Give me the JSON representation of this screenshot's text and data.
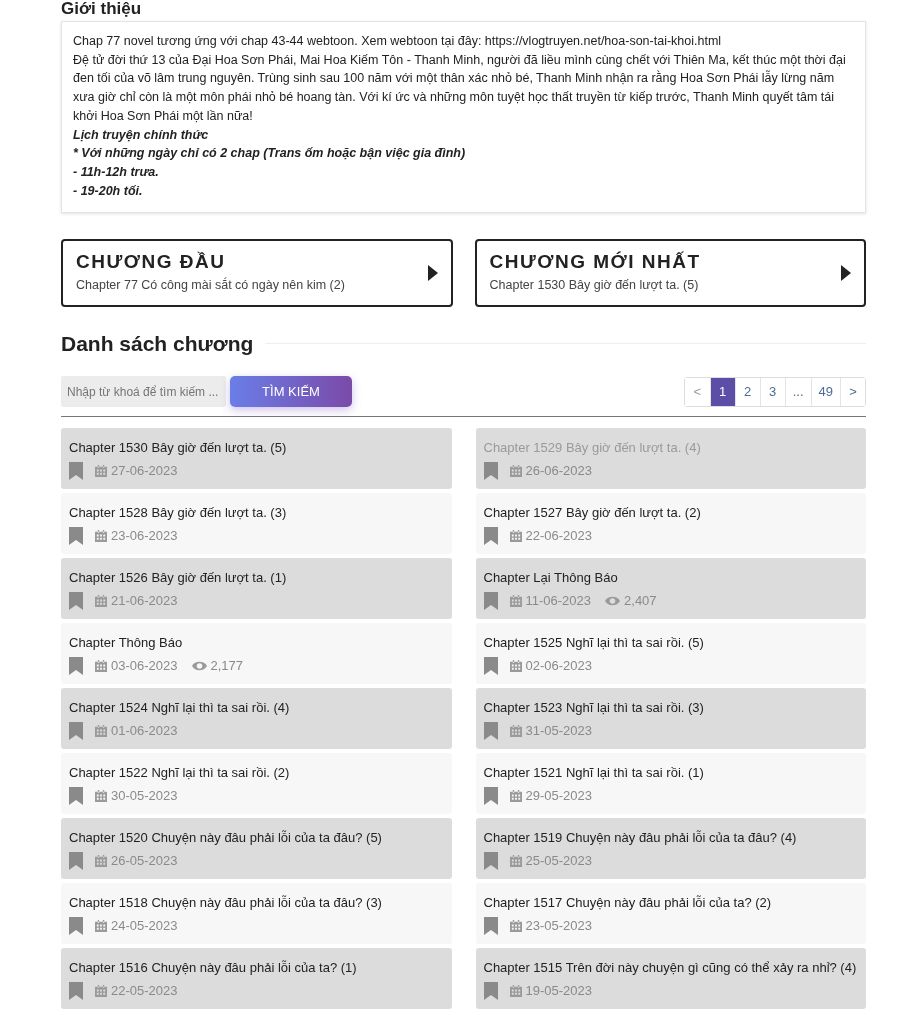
{
  "intro": {
    "title": "Giới thiệu",
    "lines": [
      {
        "kind": "plain",
        "text": "Chap 77 novel tương ứng với chap 43-44 webtoon. Xem webtoon tại đây: https://vlogtruyen.net/hoa-son-tai-khoi.html"
      },
      {
        "kind": "plain",
        "text": "Đệ tử đời thứ 13 của Đại Hoa Sơn Phái, Mai Hoa Kiếm Tôn - Thanh Minh, người đã liều mình cùng chết với Thiên Ma, kết thúc một thời đại đen tối của võ lâm trung nguyên. Trùng sinh sau 100 năm với một thân xác nhỏ bé, Thanh Minh nhận ra rằng Hoa Sơn Phái lẫy lừng năm xưa giờ chỉ còn là một môn phái nhỏ bé hoang tàn. Với kí ức và những môn tuyệt học thất truyền từ kiếp trước, Thanh Minh quyết tâm tái khởi Hoa Sơn Phái một lần nữa!"
      },
      {
        "kind": "emphasis",
        "text": "Lịch truyện chính thức"
      },
      {
        "kind": "emphasis",
        "text": "* Với những ngày chỉ có 2 chap (Trans ốm hoặc bận việc gia đình)"
      },
      {
        "kind": "emphasis",
        "text": "- 11h-12h trưa."
      },
      {
        "kind": "emphasis",
        "text": "- 19-20h tối."
      }
    ]
  },
  "shortcuts": [
    {
      "title": "CHƯƠNG ĐẦU",
      "chapter": "Chapter 77 Có công mài sắt có ngày nên kim (2)"
    },
    {
      "title": "CHƯƠNG MỚI NHẤT",
      "chapter": "Chapter 1530 Bây giờ đến lượt ta. (5)"
    }
  ],
  "chapter_list": {
    "title": "Danh sách chương",
    "search": {
      "placeholder": "Nhập từ khoá để tìm kiếm ...",
      "button": "TÌM KIẾM"
    },
    "pagination": [
      {
        "label": "<",
        "selected": false
      },
      {
        "label": "1",
        "selected": true
      },
      {
        "label": "2",
        "selected": false
      },
      {
        "label": "3",
        "selected": false
      },
      {
        "label": "...",
        "selected": false
      },
      {
        "label": "49",
        "selected": false
      },
      {
        "label": ">",
        "selected": false
      }
    ],
    "chapters": [
      {
        "title": "Chapter 1530 Bây giờ đến lượt ta. (5)",
        "date": "27-06-2023",
        "read": false
      },
      {
        "title": "Chapter 1529 Bây giờ đến lượt ta. (4)",
        "date": "26-06-2023",
        "read": true
      },
      {
        "title": "Chapter 1528 Bây giờ đến lượt ta. (3)",
        "date": "23-06-2023",
        "read": false
      },
      {
        "title": "Chapter 1527 Bây giờ đến lượt ta. (2)",
        "date": "22-06-2023",
        "read": false
      },
      {
        "title": "Chapter 1526 Bây giờ đến lượt ta. (1)",
        "date": "21-06-2023",
        "read": false
      },
      {
        "title": "Chapter Lại Thông Báo",
        "date": "11-06-2023",
        "views": "2,407",
        "read": false
      },
      {
        "title": "Chapter Thông Báo",
        "date": "03-06-2023",
        "views": "2,177",
        "read": false
      },
      {
        "title": "Chapter 1525 Nghĩ lại thì ta sai rồi. (5)",
        "date": "02-06-2023",
        "read": false
      },
      {
        "title": "Chapter 1524 Nghĩ lại thì ta sai rồi. (4)",
        "date": "01-06-2023",
        "read": false
      },
      {
        "title": "Chapter 1523 Nghĩ lại thì ta sai rồi. (3)",
        "date": "31-05-2023",
        "read": false
      },
      {
        "title": "Chapter 1522 Nghĩ lại thì ta sai rồi. (2)",
        "date": "30-05-2023",
        "read": false
      },
      {
        "title": "Chapter 1521 Nghĩ lại thì ta sai rồi. (1)",
        "date": "29-05-2023",
        "read": false
      },
      {
        "title": "Chapter 1520 Chuyện này đâu phải lỗi của ta đâu? (5)",
        "date": "26-05-2023",
        "read": false
      },
      {
        "title": "Chapter 1519 Chuyện này đâu phải lỗi của ta đâu? (4)",
        "date": "25-05-2023",
        "read": false
      },
      {
        "title": "Chapter 1518 Chuyện này đâu phải lỗi của ta đâu? (3)",
        "date": "24-05-2023",
        "read": false
      },
      {
        "title": "Chapter 1517 Chuyện này đâu phải lỗi của ta? (2)",
        "date": "23-05-2023",
        "read": false
      },
      {
        "title": "Chapter 1516 Chuyện này đâu phải lỗi của ta? (1)",
        "date": "22-05-2023",
        "read": false
      },
      {
        "title": "Chapter 1515 Trên đời này chuyện gì cũng có thể xảy ra nhỉ? (4)",
        "date": "19-05-2023",
        "read": false
      }
    ]
  }
}
